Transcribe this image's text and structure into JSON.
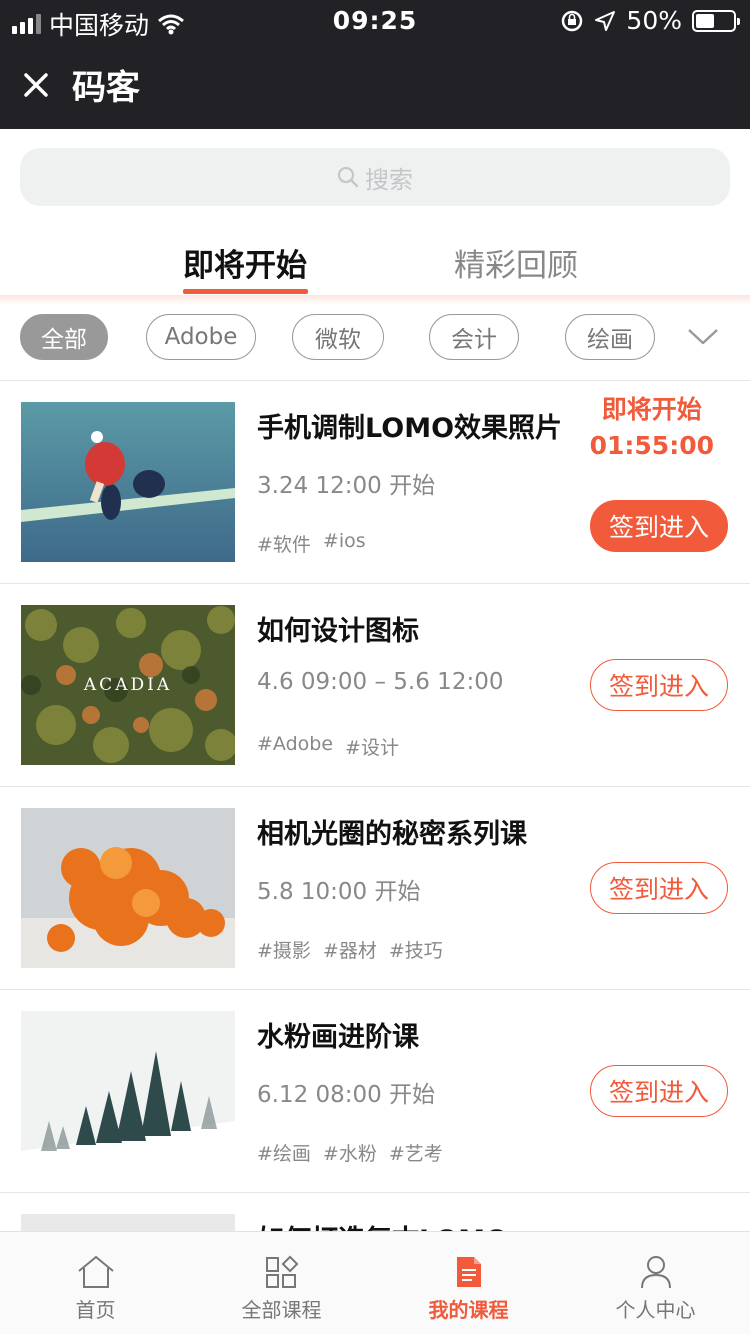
{
  "status_bar": {
    "carrier": "中国移动",
    "time": "09:25",
    "battery": "50%",
    "battery_level": 0.5
  },
  "navbar": {
    "title": "码客",
    "close_icon": "close-icon"
  },
  "search": {
    "placeholder": "搜索"
  },
  "tabs": [
    {
      "label": "即将开始",
      "active": true
    },
    {
      "label": "精彩回顾",
      "active": false
    }
  ],
  "categories": [
    {
      "label": "全部",
      "active": true
    },
    {
      "label": "Adobe"
    },
    {
      "label": "微软"
    },
    {
      "label": "会计"
    },
    {
      "label": "绘画"
    }
  ],
  "courses": [
    {
      "title": "手机调制LOMO效果照片",
      "time": "3.24 12:00 开始",
      "tags": [
        "#软件",
        "#ios"
      ],
      "status": "即将开始",
      "countdown": "01:55:00",
      "button": "签到进入",
      "filled": true
    },
    {
      "title": "如何设计图标",
      "time": "4.6 09:00 – 5.6 12:00",
      "tags": [
        "#Adobe",
        "#设计"
      ],
      "button": "签到进入",
      "thumb_text": "ACADIA"
    },
    {
      "title": "相机光圈的秘密系列课",
      "time": "5.8 10:00 开始",
      "tags": [
        "#摄影",
        "#器材",
        "#技巧"
      ],
      "button": "签到进入"
    },
    {
      "title": "水粉画进阶课",
      "time": "6.12 08:00 开始",
      "tags": [
        "#绘画",
        "#水粉",
        "#艺考"
      ],
      "button": "签到进入"
    },
    {
      "title": "如何打造复古LOMO",
      "partial": true
    }
  ],
  "tabbar": [
    {
      "label": "首页",
      "icon": "home-icon"
    },
    {
      "label": "全部课程",
      "icon": "grid-icon"
    },
    {
      "label": "我的课程",
      "icon": "document-icon",
      "active": true
    },
    {
      "label": "个人中心",
      "icon": "user-icon"
    }
  ],
  "colors": {
    "accent": "#f15a3a",
    "dark": "#222226",
    "muted": "#888888"
  }
}
